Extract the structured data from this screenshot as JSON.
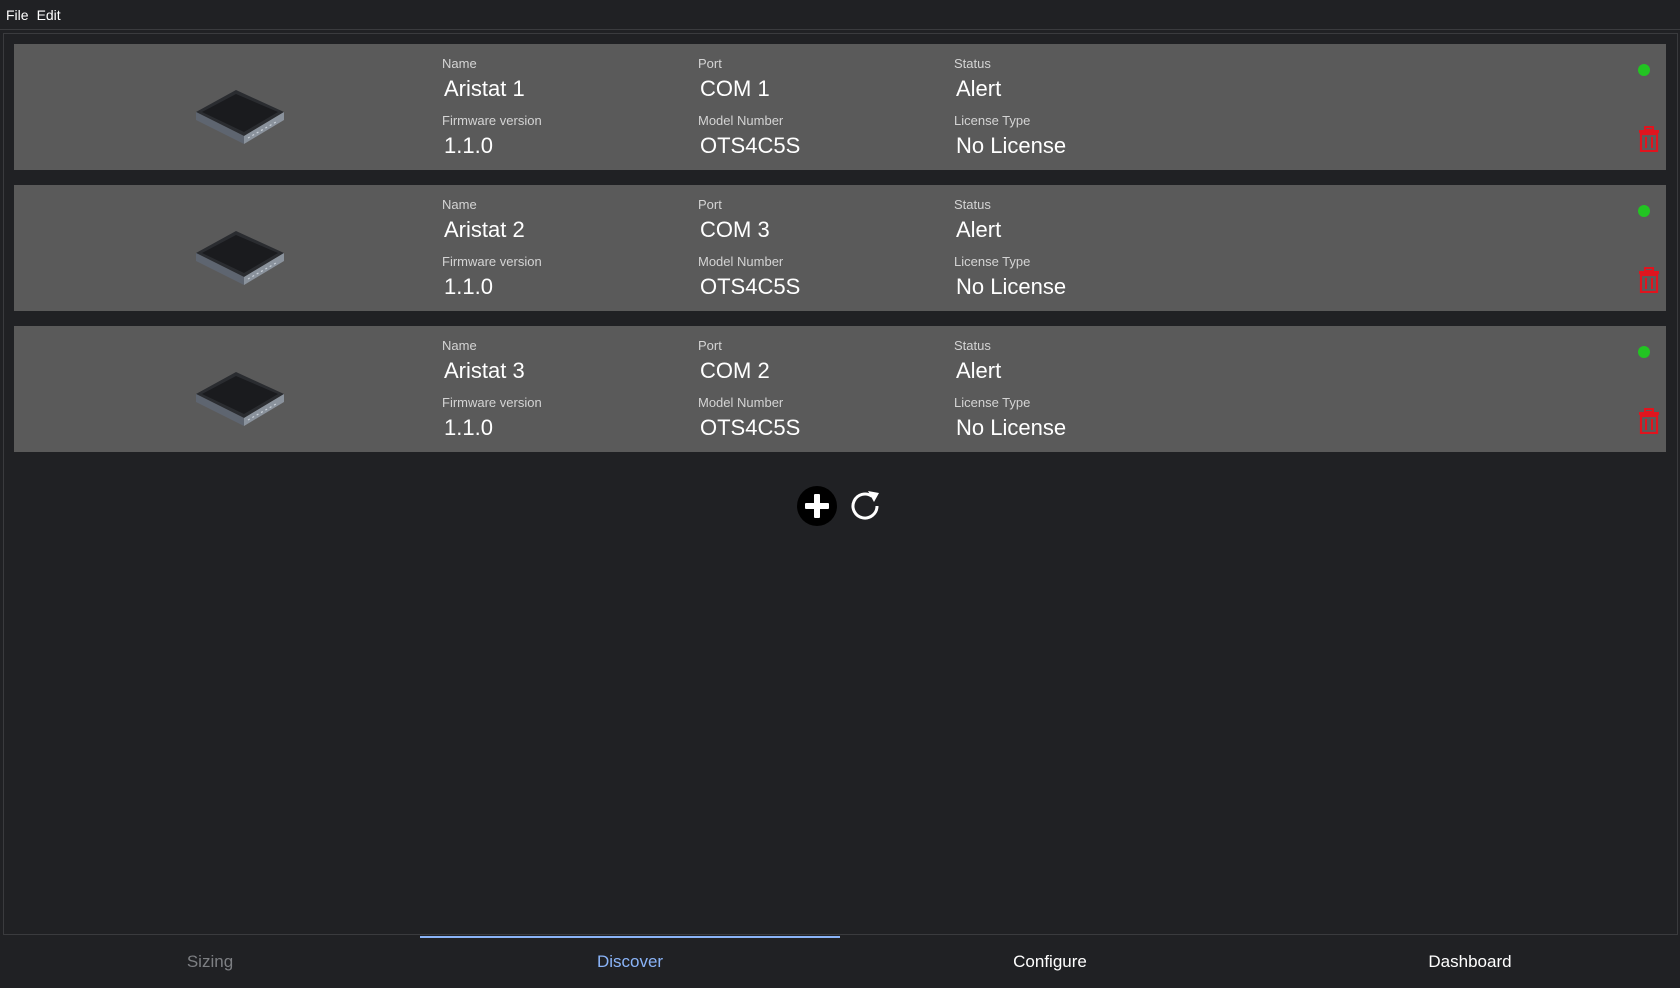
{
  "menu": {
    "items": [
      "File",
      "Edit"
    ]
  },
  "devices": [
    {
      "name_label": "Name",
      "name": "Aristat 1",
      "port_label": "Port",
      "port": "COM 1",
      "status_label": "Status",
      "status": "Alert",
      "firmware_label": "Firmware version",
      "firmware": "1.1.0",
      "model_label": "Model Number",
      "model": "OTS4C5S",
      "license_label": "License Type",
      "license": "No License"
    },
    {
      "name_label": "Name",
      "name": "Aristat 2",
      "port_label": "Port",
      "port": "COM 3",
      "status_label": "Status",
      "status": "Alert",
      "firmware_label": "Firmware version",
      "firmware": "1.1.0",
      "model_label": "Model Number",
      "model": "OTS4C5S",
      "license_label": "License Type",
      "license": "No License"
    },
    {
      "name_label": "Name",
      "name": "Aristat 3",
      "port_label": "Port",
      "port": "COM 2",
      "status_label": "Status",
      "status": "Alert",
      "firmware_label": "Firmware version",
      "firmware": "1.1.0",
      "model_label": "Model Number",
      "model": "OTS4C5S",
      "license_label": "License Type",
      "license": "No License"
    }
  ],
  "actions": {
    "add_icon": "plus-circle-icon",
    "refresh_icon": "refresh-icon"
  },
  "colors": {
    "card": "#5a5a5a",
    "status_ok": "#22c422",
    "delete": "#e0141e",
    "active_tab": "#8ab4f8"
  },
  "tabs": [
    {
      "label": "Sizing",
      "state": "disabled"
    },
    {
      "label": "Discover",
      "state": "active"
    },
    {
      "label": "Configure",
      "state": "normal"
    },
    {
      "label": "Dashboard",
      "state": "normal"
    }
  ]
}
